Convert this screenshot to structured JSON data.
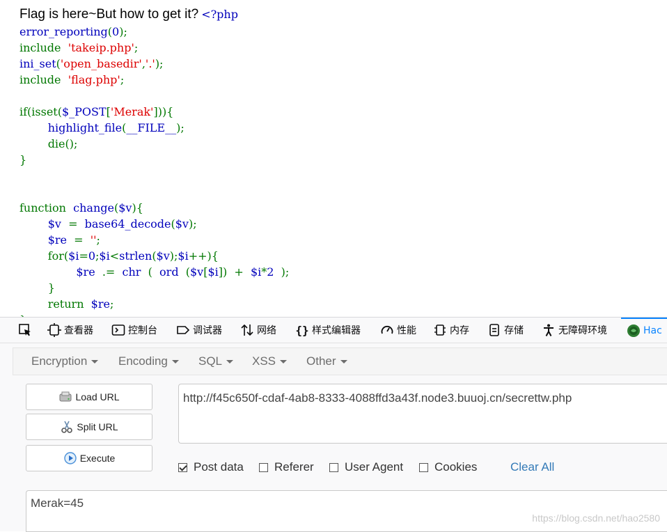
{
  "page": {
    "heading": "Flag is here~But how to get it?",
    "php_open": "<?php"
  },
  "code": [
    [
      {
        "t": "error_reporting",
        "c": "def"
      },
      {
        "t": "(",
        "c": "key"
      },
      {
        "t": "0",
        "c": "def"
      },
      {
        "t": ");",
        "c": "key"
      }
    ],
    [
      {
        "t": "include  ",
        "c": "key"
      },
      {
        "t": "'takeip.php'",
        "c": "str"
      },
      {
        "t": ";",
        "c": "key"
      }
    ],
    [
      {
        "t": "ini_set",
        "c": "def"
      },
      {
        "t": "(",
        "c": "key"
      },
      {
        "t": "'open_basedir'",
        "c": "str"
      },
      {
        "t": ",",
        "c": "key"
      },
      {
        "t": "'.'",
        "c": "str"
      },
      {
        "t": ");",
        "c": "key"
      }
    ],
    [
      {
        "t": "include  ",
        "c": "key"
      },
      {
        "t": "'flag.php'",
        "c": "str"
      },
      {
        "t": ";",
        "c": "key"
      }
    ],
    [],
    [
      {
        "t": "if(isset(",
        "c": "key"
      },
      {
        "t": "$_POST",
        "c": "def"
      },
      {
        "t": "[",
        "c": "key"
      },
      {
        "t": "'Merak'",
        "c": "str"
      },
      {
        "t": "])){",
        "c": "key"
      }
    ],
    [
      {
        "t": "        ",
        "c": "key"
      },
      {
        "t": "highlight_file",
        "c": "def"
      },
      {
        "t": "(",
        "c": "key"
      },
      {
        "t": "__FILE__",
        "c": "def"
      },
      {
        "t": ");",
        "c": "key"
      }
    ],
    [
      {
        "t": "        die();",
        "c": "key"
      }
    ],
    [
      {
        "t": "}",
        "c": "key"
      }
    ],
    [],
    [],
    [
      {
        "t": "function  ",
        "c": "key"
      },
      {
        "t": "change",
        "c": "def"
      },
      {
        "t": "(",
        "c": "key"
      },
      {
        "t": "$v",
        "c": "def"
      },
      {
        "t": "){",
        "c": "key"
      }
    ],
    [
      {
        "t": "        ",
        "c": "key"
      },
      {
        "t": "$v  ",
        "c": "def"
      },
      {
        "t": "=  ",
        "c": "key"
      },
      {
        "t": "base64_decode",
        "c": "def"
      },
      {
        "t": "(",
        "c": "key"
      },
      {
        "t": "$v",
        "c": "def"
      },
      {
        "t": ");",
        "c": "key"
      }
    ],
    [
      {
        "t": "        ",
        "c": "key"
      },
      {
        "t": "$re  ",
        "c": "def"
      },
      {
        "t": "=  ",
        "c": "key"
      },
      {
        "t": "''",
        "c": "str"
      },
      {
        "t": ";",
        "c": "key"
      }
    ],
    [
      {
        "t": "        for(",
        "c": "key"
      },
      {
        "t": "$i",
        "c": "def"
      },
      {
        "t": "=",
        "c": "key"
      },
      {
        "t": "0",
        "c": "def"
      },
      {
        "t": ";",
        "c": "key"
      },
      {
        "t": "$i",
        "c": "def"
      },
      {
        "t": "<",
        "c": "key"
      },
      {
        "t": "strlen",
        "c": "def"
      },
      {
        "t": "(",
        "c": "key"
      },
      {
        "t": "$v",
        "c": "def"
      },
      {
        "t": ");",
        "c": "key"
      },
      {
        "t": "$i",
        "c": "def"
      },
      {
        "t": "++){",
        "c": "key"
      }
    ],
    [
      {
        "t": "                ",
        "c": "key"
      },
      {
        "t": "$re  ",
        "c": "def"
      },
      {
        "t": ".=  ",
        "c": "key"
      },
      {
        "t": "chr  ",
        "c": "def"
      },
      {
        "t": "(  ",
        "c": "key"
      },
      {
        "t": "ord  ",
        "c": "def"
      },
      {
        "t": "(",
        "c": "key"
      },
      {
        "t": "$v",
        "c": "def"
      },
      {
        "t": "[",
        "c": "key"
      },
      {
        "t": "$i",
        "c": "def"
      },
      {
        "t": "])  +  ",
        "c": "key"
      },
      {
        "t": "$i",
        "c": "def"
      },
      {
        "t": "*",
        "c": "key"
      },
      {
        "t": "2  ",
        "c": "def"
      },
      {
        "t": ");",
        "c": "key"
      }
    ],
    [
      {
        "t": "        }",
        "c": "key"
      }
    ],
    [
      {
        "t": "        return  ",
        "c": "key"
      },
      {
        "t": "$re",
        "c": "def"
      },
      {
        "t": ";",
        "c": "key"
      }
    ],
    [
      {
        "t": "}",
        "c": "key"
      }
    ]
  ],
  "devtools": {
    "tabs": [
      {
        "label": "",
        "icon": "pick-element-icon"
      },
      {
        "label": "查看器",
        "icon": "inspector-icon"
      },
      {
        "label": "控制台",
        "icon": "console-icon"
      },
      {
        "label": "调试器",
        "icon": "debugger-icon"
      },
      {
        "label": "网络",
        "icon": "network-icon"
      },
      {
        "label": "样式编辑器",
        "icon": "style-editor-icon"
      },
      {
        "label": "性能",
        "icon": "performance-icon"
      },
      {
        "label": "内存",
        "icon": "memory-icon"
      },
      {
        "label": "存储",
        "icon": "storage-icon"
      },
      {
        "label": "无障碍环境",
        "icon": "accessibility-icon"
      },
      {
        "label": "Hac",
        "icon": "hackbar-icon"
      }
    ]
  },
  "hackbar": {
    "menus": [
      "Encryption",
      "Encoding",
      "SQL",
      "XSS",
      "Other"
    ],
    "buttons": {
      "load": "Load URL",
      "split": "Split URL",
      "execute": "Execute"
    },
    "url": "http://f45c650f-cdaf-4ab8-8333-4088ffd3a43f.node3.buuoj.cn/secrettw.php",
    "options": [
      {
        "label": "Post data",
        "checked": true
      },
      {
        "label": "Referer",
        "checked": false
      },
      {
        "label": "User Agent",
        "checked": false
      },
      {
        "label": "Cookies",
        "checked": false
      }
    ],
    "clear_all": "Clear All",
    "post_body": "Merak=45"
  },
  "watermark": "https://blog.csdn.net/hao2580",
  "colors": {
    "php_default": "#0000BB",
    "php_keyword": "#007700",
    "php_string": "#DD0000",
    "accent": "#0a84ff",
    "link": "#337ab7"
  }
}
